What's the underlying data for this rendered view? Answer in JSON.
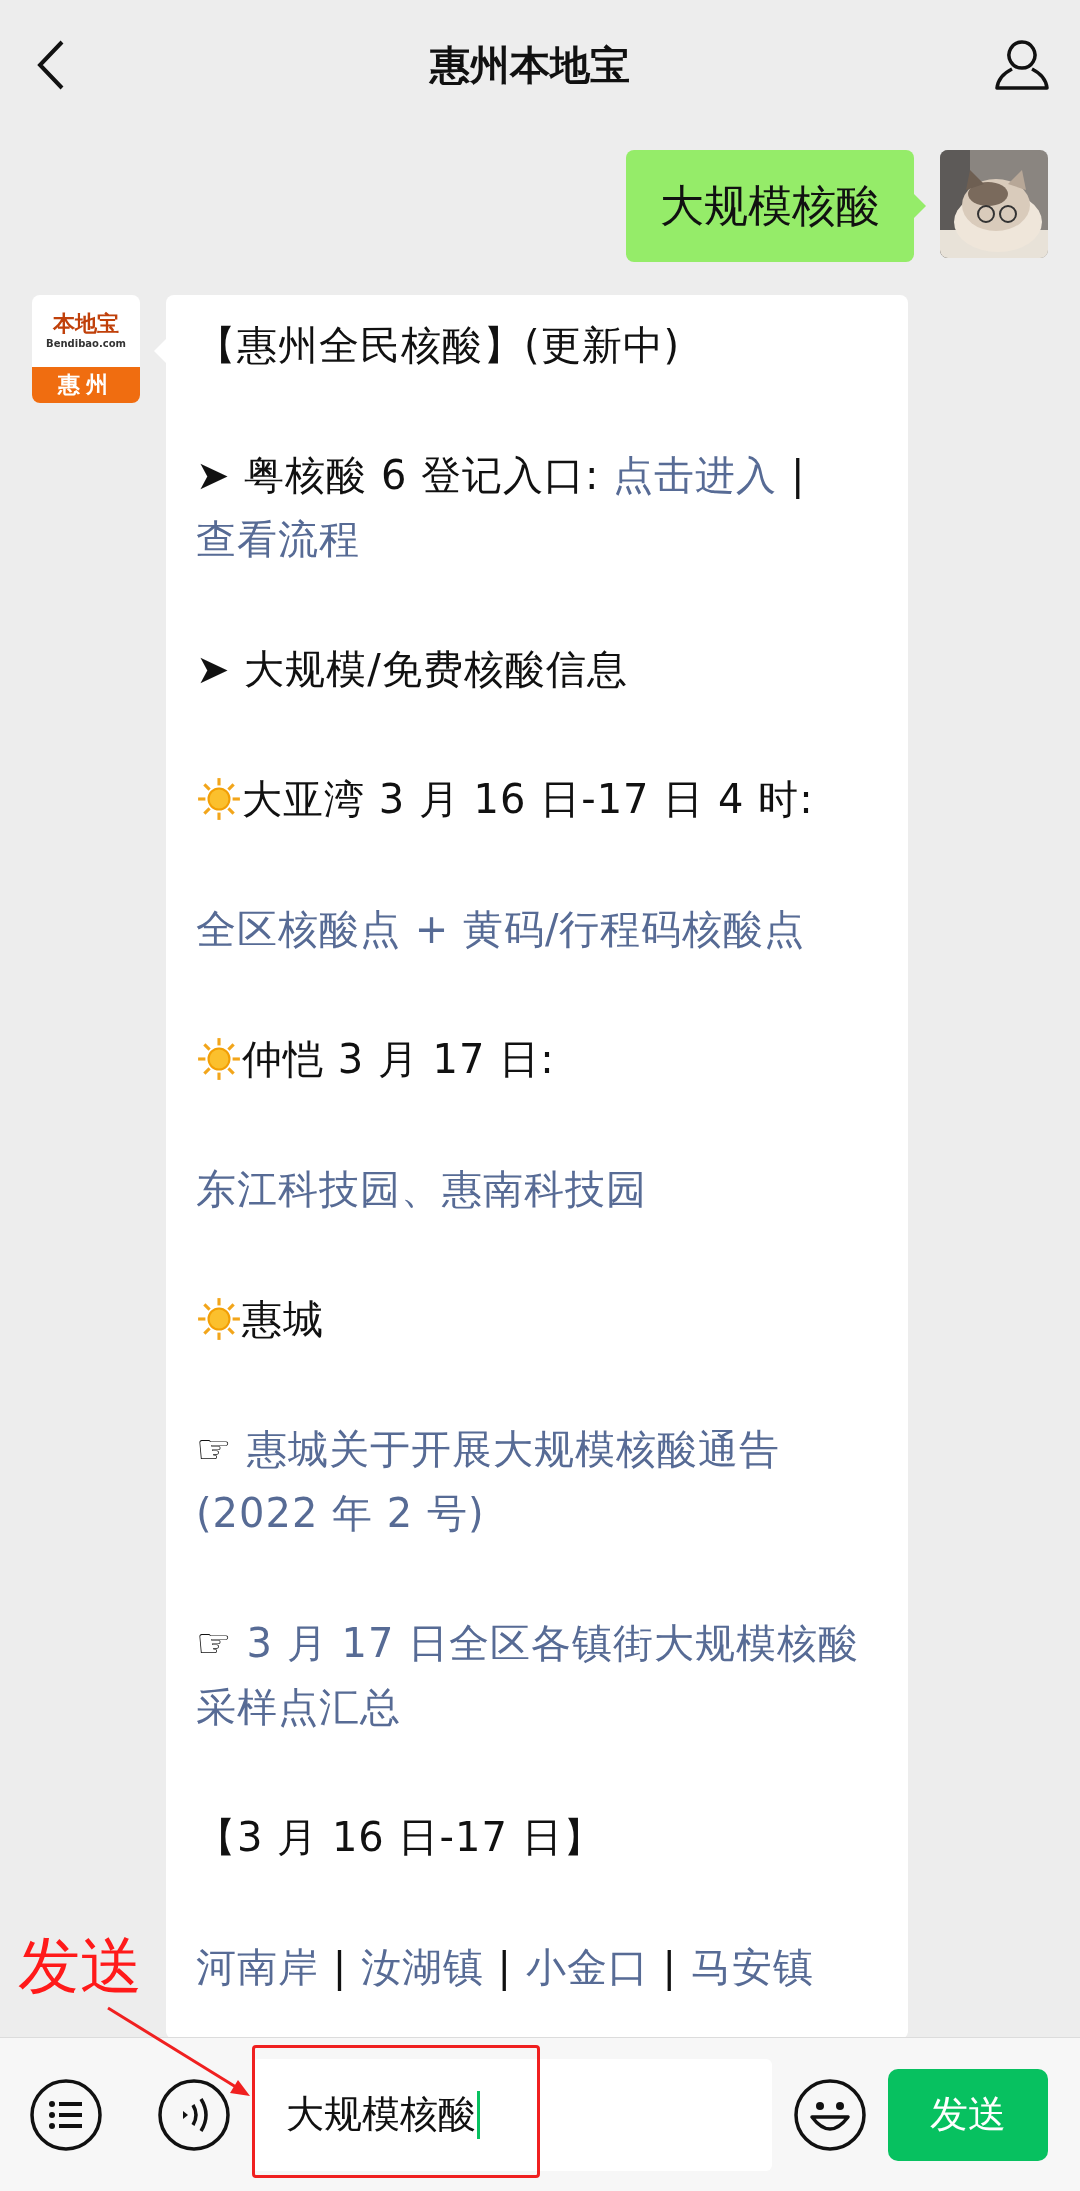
{
  "header": {
    "title": "惠州本地宝"
  },
  "outgoing_message": {
    "text": "大规模核酸"
  },
  "incoming_avatar": {
    "logo_top": "本地宝",
    "logo_site": "Bendibao.com",
    "logo_city": "惠州"
  },
  "article": {
    "paragraphs": [
      {
        "kind": "text",
        "segments": [
          {
            "kind": "text",
            "text": "【惠州全民核酸】(更新中)"
          }
        ]
      },
      {
        "kind": "text",
        "segments": [
          {
            "kind": "text",
            "text": "➤ 粤核酸 6 登记入口: "
          },
          {
            "kind": "link",
            "text": "点击进入"
          },
          {
            "kind": "text",
            "text": " | "
          },
          {
            "kind": "link",
            "text": "查看流程"
          }
        ]
      },
      {
        "kind": "text",
        "segments": [
          {
            "kind": "text",
            "text": "➤ 大规模/免费核酸信息"
          }
        ]
      },
      {
        "kind": "sun",
        "segments": [
          {
            "kind": "text",
            "text": "大亚湾 3 月 16 日-17 日 4 时:"
          }
        ]
      },
      {
        "kind": "text",
        "segments": [
          {
            "kind": "link",
            "text": "全区核酸点 + 黄码/行程码核酸点"
          }
        ]
      },
      {
        "kind": "sun",
        "segments": [
          {
            "kind": "text",
            "text": "仲恺 3 月 17 日:"
          }
        ]
      },
      {
        "kind": "text",
        "segments": [
          {
            "kind": "link",
            "text": "东江科技园、惠南科技园"
          }
        ]
      },
      {
        "kind": "sun",
        "segments": [
          {
            "kind": "text",
            "text": "惠城"
          }
        ]
      },
      {
        "kind": "text",
        "segments": [
          {
            "kind": "text",
            "text": "☞ "
          },
          {
            "kind": "link",
            "text": "惠城关于开展大规模核酸通告(2022 年 2 号)"
          }
        ]
      },
      {
        "kind": "text",
        "segments": [
          {
            "kind": "text",
            "text": "☞ "
          },
          {
            "kind": "link",
            "text": "3 月 17 日全区各镇街大规模核酸采样点汇总"
          }
        ]
      },
      {
        "kind": "text",
        "segments": [
          {
            "kind": "text",
            "text": "【3 月 16 日-17 日】"
          }
        ]
      },
      {
        "kind": "text",
        "segments": [
          {
            "kind": "link",
            "text": "河南岸"
          },
          {
            "kind": "text",
            "text": " | "
          },
          {
            "kind": "link",
            "text": "汝湖镇"
          },
          {
            "kind": "text",
            "text": " | "
          },
          {
            "kind": "link",
            "text": "小金口"
          },
          {
            "kind": "text",
            "text": " | "
          },
          {
            "kind": "link",
            "text": "马安镇"
          }
        ]
      }
    ]
  },
  "input_bar": {
    "value": "大规模核酸",
    "send_button": "发送"
  },
  "annotation": {
    "label": "发送"
  }
}
